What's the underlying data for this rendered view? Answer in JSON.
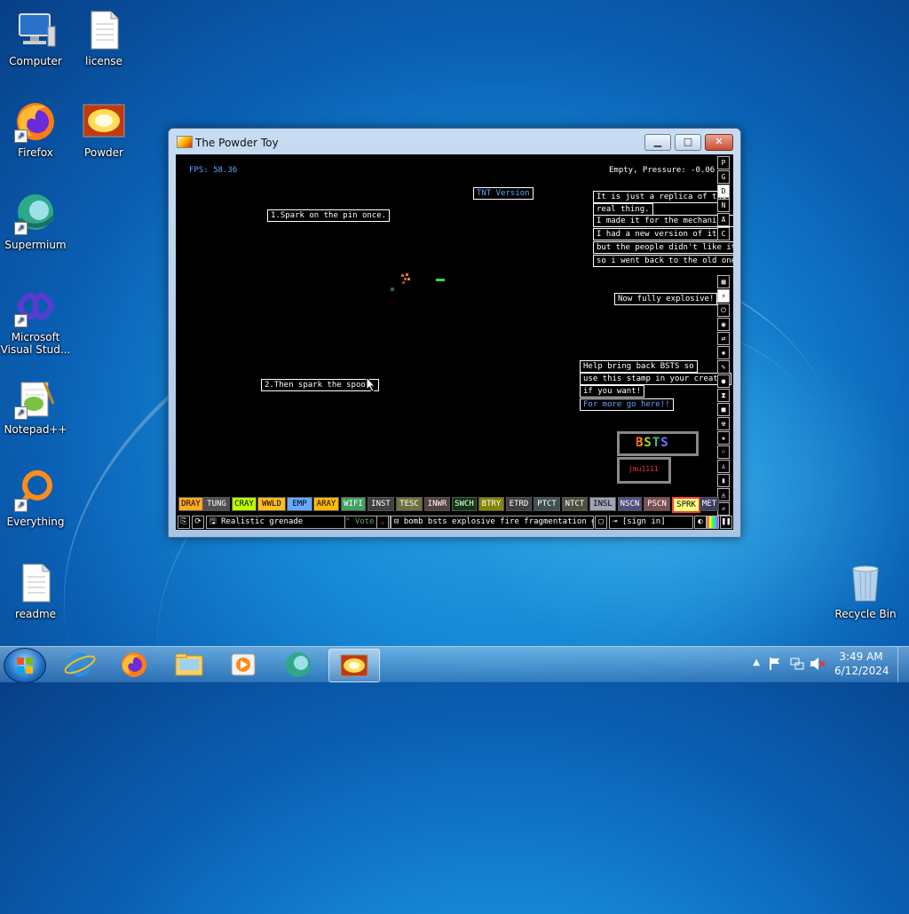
{
  "desktop": {
    "icons": [
      {
        "label": "Computer"
      },
      {
        "label": "license"
      },
      {
        "label": "Firefox"
      },
      {
        "label": "Powder"
      },
      {
        "label": "Supermium"
      },
      {
        "label": "Microsoft Visual Stud..."
      },
      {
        "label": "Notepad++"
      },
      {
        "label": "Everything"
      },
      {
        "label": "readme"
      },
      {
        "label": "Recycle Bin"
      }
    ]
  },
  "window": {
    "title": "The Powder Toy",
    "min_label": "▁",
    "max_label": "□",
    "close_label": "✕"
  },
  "game": {
    "fps": "FPS: 58.36",
    "status": "Empty, Pressure: -0.06",
    "notes": {
      "tnt": "TNT Version",
      "pin": "1.Spark on the pin once.",
      "spoon": "2.Then spark the spoon.",
      "replica1": "It is just a replica of the",
      "replica2": "real thing.",
      "replica3": "I made it for the mechanism.",
      "replica4": "I had a new version of it,",
      "replica5": "but the people didn't like it,",
      "replica6": "so i went back to the old one!",
      "explosive": "Now fully explosive!",
      "bsts1": "Help bring back BSTS so",
      "bsts2": "use this stamp in your creatio",
      "bsts3": "if you want!",
      "more": "For more go here!!",
      "logo": "BSTS",
      "author": "jmu1111"
    },
    "sidebar_letters": [
      "P",
      "G",
      "D",
      "N",
      "A",
      "C"
    ],
    "elements": [
      {
        "label": "DRAY",
        "color": "#ffaa22"
      },
      {
        "label": "TUNG",
        "color": "#505050"
      },
      {
        "label": "CRAY",
        "color": "#bbff00"
      },
      {
        "label": "WWLD",
        "color": "#ffbb22"
      },
      {
        "label": "EMP",
        "color": "#66aaff"
      },
      {
        "label": "ARAY",
        "color": "#ffbb00"
      },
      {
        "label": "WIFI",
        "color": "#40a060"
      },
      {
        "label": "INST",
        "color": "#404040"
      },
      {
        "label": "TESC",
        "color": "#707040"
      },
      {
        "label": "INWR",
        "color": "#544141"
      },
      {
        "label": "SWCH",
        "color": "#103b11"
      },
      {
        "label": "BTRY",
        "color": "#858505"
      },
      {
        "label": "ETRD",
        "color": "#404040"
      },
      {
        "label": "PTCT",
        "color": "#405050"
      },
      {
        "label": "NTCT",
        "color": "#505040"
      },
      {
        "label": "INSL",
        "color": "#9ea3b6"
      },
      {
        "label": "NSCN",
        "color": "#505080"
      },
      {
        "label": "PSCN",
        "color": "#805050"
      },
      {
        "label": "SPRK",
        "color": "#ffff80"
      },
      {
        "label": "MET",
        "color": "#404060"
      }
    ],
    "bottom": {
      "save_name": "Realistic grenade",
      "vote_label": "Vote",
      "tags": "bomb bsts explosive fire fragmentation g...",
      "sign_in": "[sign in]"
    }
  },
  "taskbar": {
    "time": "3:49 AM",
    "date": "6/12/2024"
  }
}
